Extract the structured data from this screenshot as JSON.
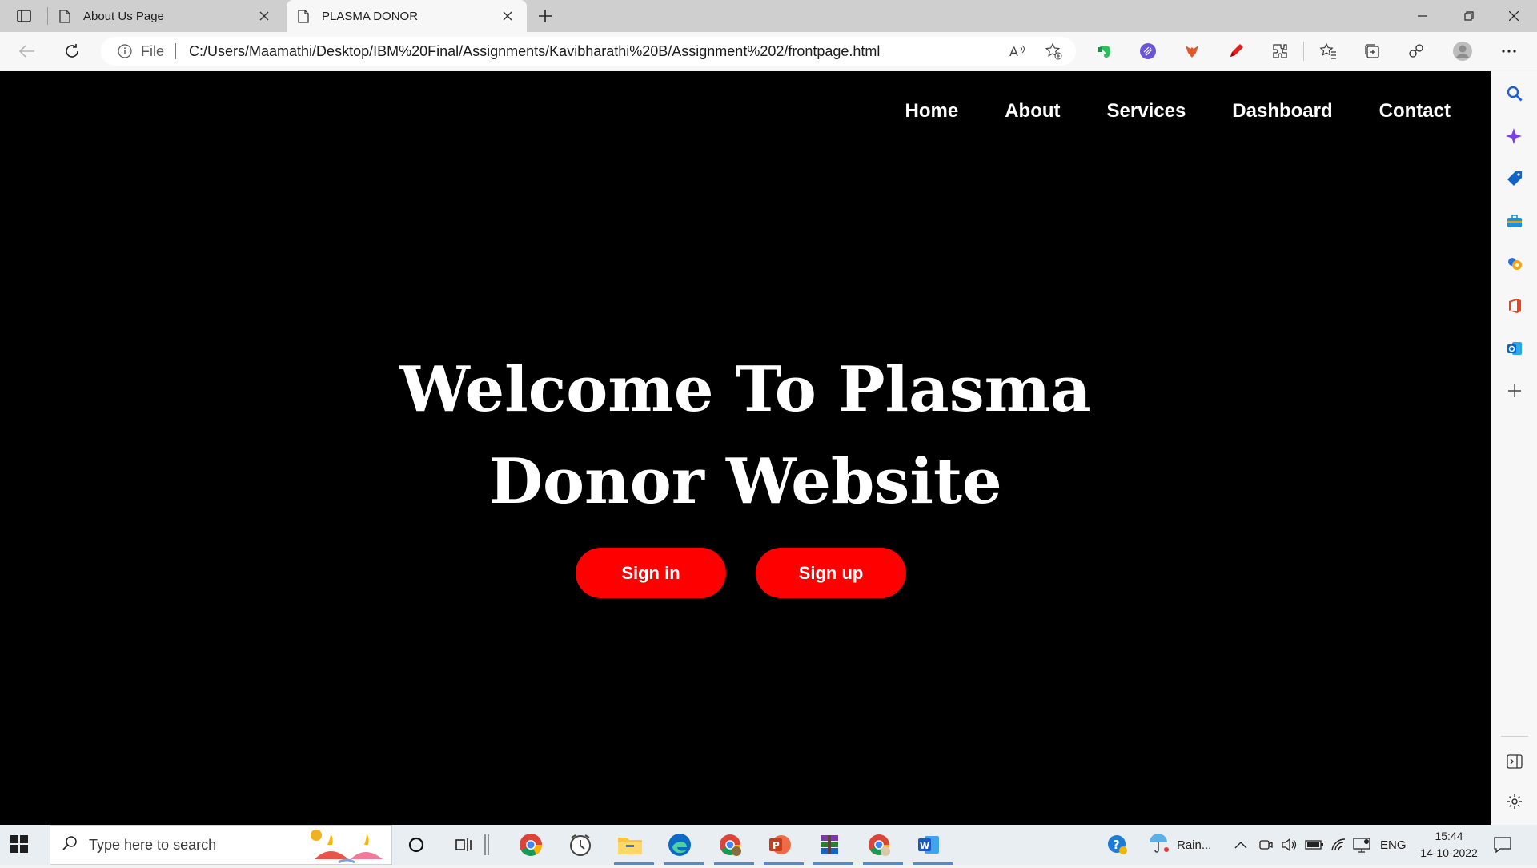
{
  "browser": {
    "tabs": [
      {
        "title": "About Us Page",
        "active": false
      },
      {
        "title": "PLASMA DONOR",
        "active": true
      }
    ],
    "address": {
      "scheme_label": "File",
      "url": "C:/Users/Maamathi/Desktop/IBM%20Final/Assignments/Kavibharathi%20B/Assignment%202/frontpage.html"
    }
  },
  "page": {
    "nav": [
      "Home",
      "About",
      "Services",
      "Dashboard",
      "Contact"
    ],
    "hero": {
      "line1": "Welcome To Plasma",
      "line2": "Donor Website"
    },
    "buttons": {
      "signin": "Sign in",
      "signup": "Sign up"
    },
    "colors": {
      "background": "#000000",
      "accent": "#ff0000",
      "text": "#ffffff"
    }
  },
  "taskbar": {
    "search_placeholder": "Type here to search",
    "weather": "Rain...",
    "language": "ENG",
    "time": "15:44",
    "date": "14-10-2022"
  }
}
